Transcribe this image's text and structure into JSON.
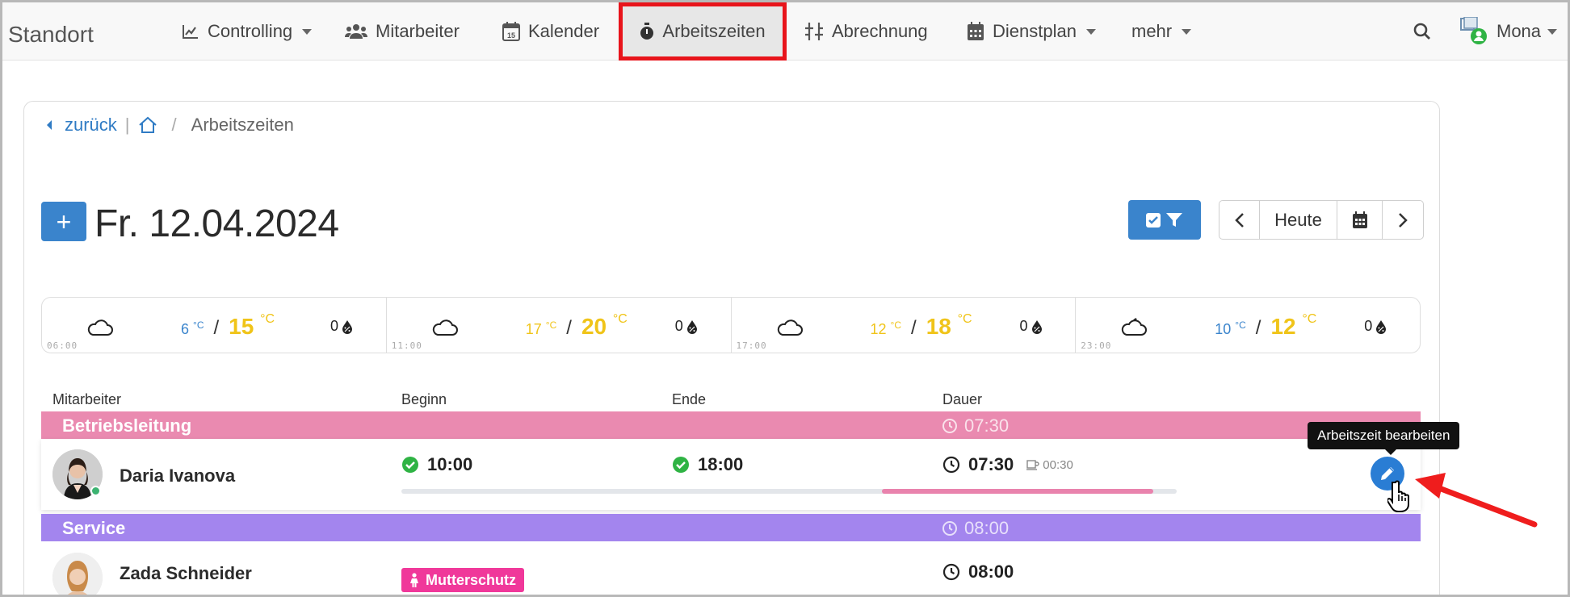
{
  "navbar": {
    "brand": "Standort",
    "items": [
      {
        "label": "Controlling",
        "icon": "chart-line-icon",
        "dropdown": true
      },
      {
        "label": "Mitarbeiter",
        "icon": "users-icon",
        "dropdown": false
      },
      {
        "label": "Kalender",
        "icon": "calendar-15-icon",
        "dropdown": false
      },
      {
        "label": "Arbeitszeiten",
        "icon": "stopwatch-icon",
        "dropdown": false,
        "active": true
      },
      {
        "label": "Abrechnung",
        "icon": "sliders-icon",
        "dropdown": false
      },
      {
        "label": "Dienstplan",
        "icon": "calendar-grid-icon",
        "dropdown": true
      },
      {
        "label": "mehr",
        "dropdown": true
      }
    ],
    "user_name": "Mona"
  },
  "breadcrumb": {
    "back_label": "zurück",
    "separator_bar": "|",
    "separator_slash": "/",
    "current": "Arbeitszeiten"
  },
  "header": {
    "add_label": "+",
    "date": "Fr. 12.04.2024",
    "today_label": "Heute"
  },
  "weather": [
    {
      "time": "06:00",
      "min": "6",
      "max": "15",
      "unit": "°C",
      "rain": "0",
      "min_color": "#3a84cc",
      "icon": "cloud-icon"
    },
    {
      "time": "11:00",
      "min": "17",
      "max": "20",
      "unit": "°C",
      "rain": "0",
      "min_color": "#f0c419",
      "icon": "cloud-icon"
    },
    {
      "time": "17:00",
      "min": "12",
      "max": "18",
      "unit": "°C",
      "rain": "0",
      "min_color": "#f0c419",
      "icon": "cloud-icon"
    },
    {
      "time": "23:00",
      "min": "10",
      "max": "12",
      "unit": "°C",
      "rain": "0",
      "min_color": "#3a84cc",
      "icon": "cloud-moon-icon"
    }
  ],
  "table": {
    "columns": [
      "Mitarbeiter",
      "Beginn",
      "Ende",
      "Dauer"
    ]
  },
  "groups": [
    {
      "name": "Betriebsleitung",
      "duration": "07:30",
      "color": "#ea8ab0"
    },
    {
      "name": "Service",
      "duration": "08:00",
      "color": "#a385ee"
    }
  ],
  "rows": [
    {
      "name": "Daria Ivanova",
      "start": "10:00",
      "end": "18:00",
      "duration": "07:30",
      "pause": "00:30",
      "progress_start": 0.62,
      "progress_end": 0.97,
      "tooltip": "Arbeitszeit bearbeiten"
    },
    {
      "name": "Zada Schneider",
      "badge": "Mutterschutz",
      "duration": "08:00"
    }
  ],
  "colors": {
    "primary": "#3a84cc",
    "active_outline": "#e8141b",
    "success": "#2fb344",
    "warm": "#f0c419",
    "badge": "#f0389a"
  }
}
